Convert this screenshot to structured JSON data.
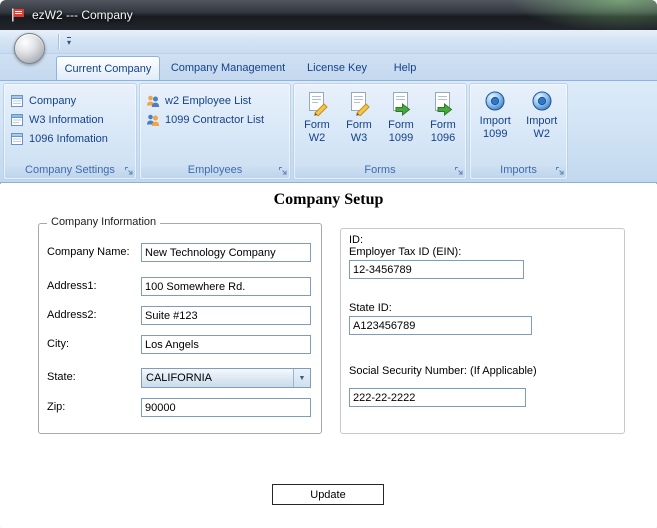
{
  "window": {
    "title": "ezW2 --- Company"
  },
  "icons": {
    "qat_arrow": "▾",
    "combo_arrow": "▼"
  },
  "tabs": [
    {
      "label": "Current Company",
      "active": true
    },
    {
      "label": "Company Management",
      "active": false
    },
    {
      "label": "License Key",
      "active": false
    },
    {
      "label": "Help",
      "active": false
    }
  ],
  "ribbon": {
    "groups": [
      {
        "label": "Company Settings",
        "items": [
          {
            "label": "Company"
          },
          {
            "label": "W3 Information"
          },
          {
            "label": "1096 Infomation"
          }
        ]
      },
      {
        "label": "Employees",
        "items": [
          {
            "label": "w2 Employee List"
          },
          {
            "label": "1099 Contractor List"
          }
        ]
      },
      {
        "label": "Forms",
        "items": [
          {
            "top": "Form",
            "bottom": "W2"
          },
          {
            "top": "Form",
            "bottom": "W3"
          },
          {
            "top": "Form",
            "bottom": "1099"
          },
          {
            "top": "Form",
            "bottom": "1096"
          }
        ]
      },
      {
        "label": "Imports",
        "items": [
          {
            "top": "Import",
            "bottom": "1099"
          },
          {
            "top": "Import",
            "bottom": "W2"
          }
        ]
      }
    ]
  },
  "main": {
    "title": "Company Setup",
    "company_info": {
      "legend": "Company Information",
      "fields": [
        {
          "label": "Company Name:",
          "value": "New Technology Company"
        },
        {
          "label": "Address1:",
          "value": "100 Somewhere Rd."
        },
        {
          "label": "Address2:",
          "value": "Suite #123"
        },
        {
          "label": "City:",
          "value": "Los Angels"
        },
        {
          "label": "State:",
          "value": "CALIFORNIA"
        },
        {
          "label": "Zip:",
          "value": "90000"
        }
      ]
    },
    "id_info": {
      "heading": "ID:",
      "fields": [
        {
          "label": "Employer Tax ID (EIN):",
          "value": "12-3456789"
        },
        {
          "label": "State ID:",
          "value": "A123456789"
        },
        {
          "label": "Social Security Number: (If Applicable)",
          "value": "222-22-2222"
        }
      ]
    },
    "update_button": "Update"
  },
  "colors": {
    "ribbon_text": "#15428b",
    "ribbon_bg": "#d6e6f6",
    "titlebar_bg": "#22252b",
    "input_border": "#7f9db9"
  }
}
